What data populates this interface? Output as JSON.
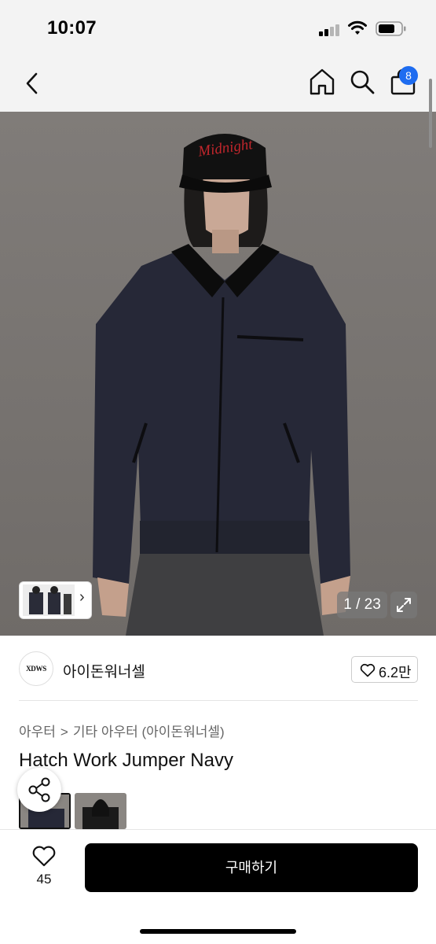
{
  "status_bar": {
    "time": "10:07"
  },
  "nav": {
    "back_icon": "chevron-left-icon",
    "home_icon": "home-icon",
    "search_icon": "search-icon",
    "cart_icon": "shopping-bag-icon",
    "cart_count": "8",
    "badge_color": "#1e6cf0"
  },
  "gallery": {
    "counter": "1 / 23",
    "expand_icon": "expand-icon",
    "thumb_arrow": "›",
    "cap_text": "Midnight"
  },
  "shop": {
    "logo_text": "XDWS",
    "name": "아이돈워너셀",
    "likes": "6.2만"
  },
  "breadcrumb": {
    "level1": "아우터",
    "separator": ">",
    "level2": "기타 아우터 (아이돈워너셀)"
  },
  "product": {
    "title": "Hatch Work Jumper Navy"
  },
  "bottom_bar": {
    "wish_count": "45",
    "buy_label": "구매하기"
  },
  "colors": {
    "accent": "#1e6cf0",
    "button": "#000000"
  }
}
